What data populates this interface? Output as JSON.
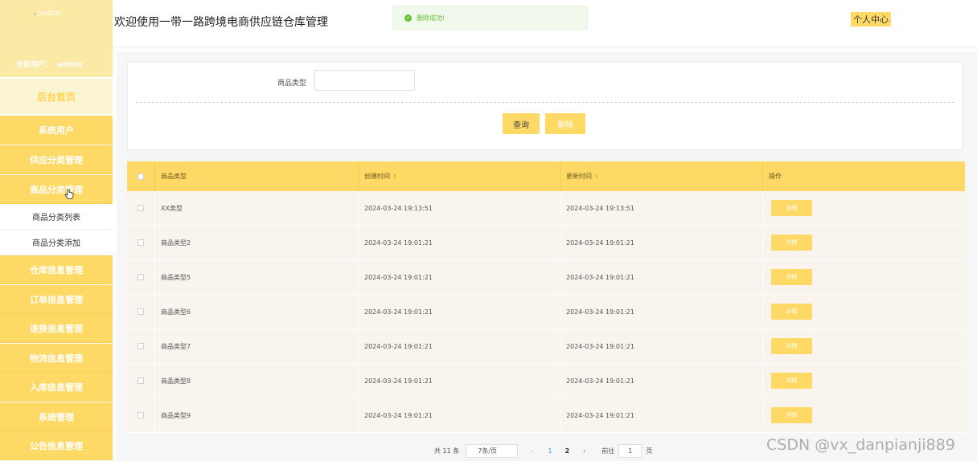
{
  "sidebar": {
    "avatar_alt": "avatar",
    "current_user_label": "当前用户：",
    "current_user": "admin",
    "home": "后台首页",
    "menu": [
      {
        "label": "系统用户"
      },
      {
        "label": "供应分类管理"
      },
      {
        "label": "商品分类管理"
      },
      {
        "label": "仓库信息管理"
      },
      {
        "label": "订单信息管理"
      },
      {
        "label": "退换信息管理"
      },
      {
        "label": "物流信息管理"
      },
      {
        "label": "入库信息管理"
      },
      {
        "label": "系统管理"
      },
      {
        "label": "公告信息管理"
      }
    ],
    "submenu": [
      {
        "label": "商品分类列表"
      },
      {
        "label": "商品分类添加"
      }
    ]
  },
  "header": {
    "title": "欢迎使用一带一路跨境电商供应链仓库管理",
    "toast": "删除成功!",
    "user_center": "个人中心"
  },
  "search": {
    "label": "商品类型",
    "value": "",
    "query_button": "查询",
    "delete_button": "删除"
  },
  "table": {
    "columns": [
      "商品类型",
      "创建时间",
      "更新时间",
      "操作"
    ],
    "rows": [
      {
        "type": "XX类型",
        "created": "2024-03-24 19:13:51",
        "updated": "2024-03-24 19:13:51",
        "action": "详情"
      },
      {
        "type": "商品类型2",
        "created": "2024-03-24 19:01:21",
        "updated": "2024-03-24 19:01:21",
        "action": "详情"
      },
      {
        "type": "商品类型5",
        "created": "2024-03-24 19:01:21",
        "updated": "2024-03-24 19:01:21",
        "action": "详情"
      },
      {
        "type": "商品类型6",
        "created": "2024-03-24 19:01:21",
        "updated": "2024-03-24 19:01:21",
        "action": "详情"
      },
      {
        "type": "商品类型7",
        "created": "2024-03-24 19:01:21",
        "updated": "2024-03-24 19:01:21",
        "action": "详情"
      },
      {
        "type": "商品类型8",
        "created": "2024-03-24 19:01:21",
        "updated": "2024-03-24 19:01:21",
        "action": "详情"
      },
      {
        "type": "商品类型9",
        "created": "2024-03-24 19:01:21",
        "updated": "2024-03-24 19:01:21",
        "action": "详情"
      }
    ]
  },
  "pagination": {
    "total": "共 11 条",
    "page_size": "7条/页",
    "prev": "‹",
    "pages": [
      "1",
      "2"
    ],
    "current_page": "1",
    "next": "›",
    "goto_label": "前往",
    "goto_value": "1",
    "page_unit": "页"
  },
  "watermark": "CSDN @vx_danpianji889",
  "colors": {
    "accent": "#ffd966",
    "profile_bg": "#faeaa6",
    "row_bg": "#faf4ee",
    "success": "#67c23a",
    "pager_active": "#409eff"
  }
}
